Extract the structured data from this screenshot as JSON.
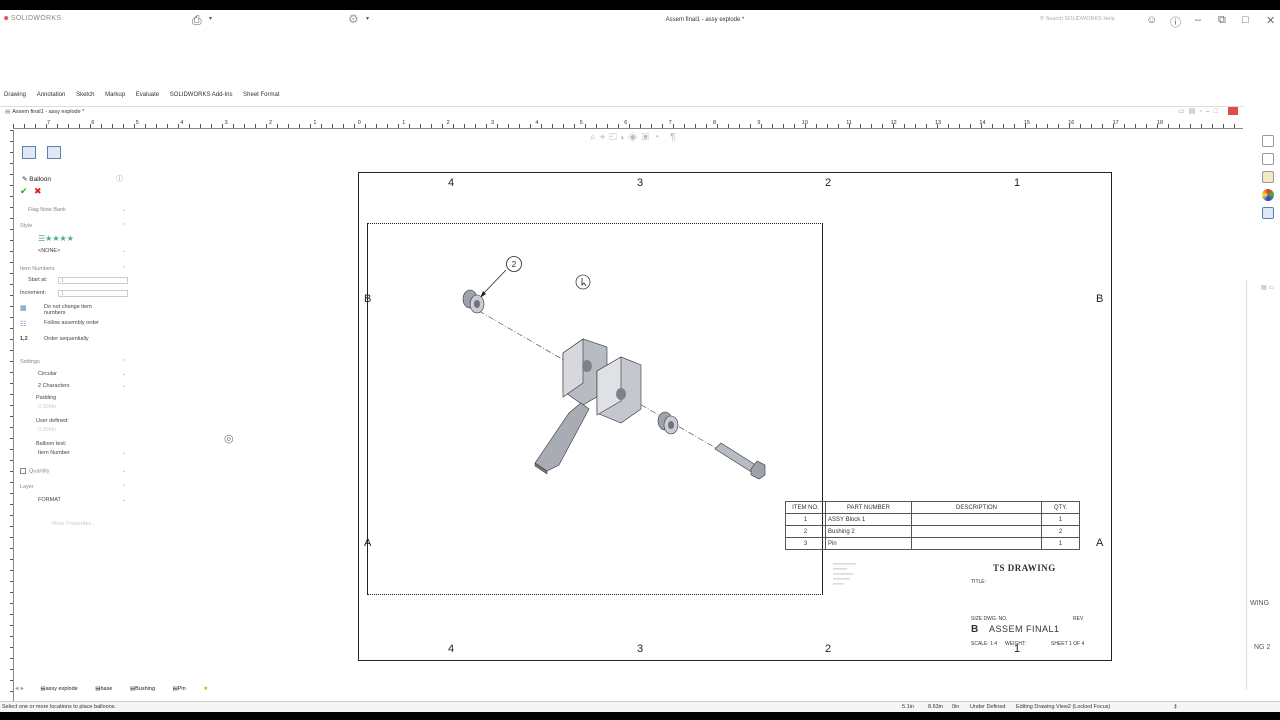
{
  "app": {
    "logo_text": "SOLIDWORKS",
    "doc_title": "Assem final1 - assy explode *",
    "search_placeholder": "Search SOLIDWORKS Help"
  },
  "tabs": [
    "Drawing",
    "Annotation",
    "Sketch",
    "Markup",
    "Evaluate",
    "SOLIDWORKS Add-Ins",
    "Sheet Format"
  ],
  "doc_tab": "Assem final1 - assy explode *",
  "ruler": [
    "7",
    "6",
    "5",
    "4",
    "3",
    "2",
    "1",
    "0",
    "1",
    "2",
    "3",
    "4",
    "5",
    "6",
    "7",
    "8",
    "9",
    "10",
    "11",
    "12",
    "13",
    "14",
    "15",
    "16",
    "17",
    "18"
  ],
  "property_manager": {
    "title": "Balloon",
    "flag_note_bank": "Flag Note Bank",
    "style_section": "Style",
    "style_value": "<NONE>",
    "item_numbers_section": "Item Numbers",
    "start_at_label": "Start at:",
    "start_at_value": "1",
    "increment_label": "Increment:",
    "increment_value": "1",
    "opt_dont_change": "Do not change item numbers",
    "opt_follow": "Follow assembly order",
    "opt_sequential": "Order sequentially",
    "seq_icon": "1,2",
    "settings_section": "Settings",
    "shape": "Circular",
    "size": "2 Characters",
    "padding_label": "Padding",
    "padding_value": "0.000in",
    "user_defined_label": "User defined:",
    "user_defined_value": "0.000in",
    "balloon_text_label": "Balloon text:",
    "balloon_text_value": "Item Number",
    "quantity_label": "Quantity",
    "layer_section": "Layer",
    "layer_value": "FORMAT",
    "more_properties": "More Properties..."
  },
  "sheet": {
    "zones_top": [
      "4",
      "3",
      "2",
      "1"
    ],
    "zones_bottom": [
      "4",
      "3",
      "2",
      "1"
    ],
    "zone_b": "B",
    "zone_a": "A",
    "balloon_number": "2"
  },
  "bom": {
    "headers": [
      "ITEM NO.",
      "PART NUMBER",
      "DESCRIPTION",
      "QTY."
    ],
    "rows": [
      [
        "1",
        "ASSY Block 1",
        "",
        "1"
      ],
      [
        "2",
        "Bushing 2",
        "",
        "2"
      ],
      [
        "3",
        "Pin",
        "",
        "1"
      ]
    ]
  },
  "title_block": {
    "company": "TS DRAWING",
    "title_label": "TITLE:",
    "size_label": "SIZE DWG. NO.",
    "rev_label": "REV",
    "size": "B",
    "dwg_no": "ASSEM FINAL1",
    "scale": "SCALE: 1:4",
    "weight": "WEIGHT:",
    "sheet": "SHEET 1 OF 4"
  },
  "sheet_tabs": [
    "assy explode",
    "base",
    "Bushing",
    "Pin"
  ],
  "status": {
    "message": "Select one or more locations to place balloons.",
    "x": "5.1in",
    "y": "8.63in",
    "z": "0in",
    "defined": "Under Defined",
    "editing": "Editing Drawing View2 (Locked Focus)"
  },
  "side_texts": [
    "WING",
    "NG 2"
  ],
  "colors": {
    "accent": "#5a7fb0",
    "logo": "#d33333",
    "close": "#e04b4b"
  }
}
